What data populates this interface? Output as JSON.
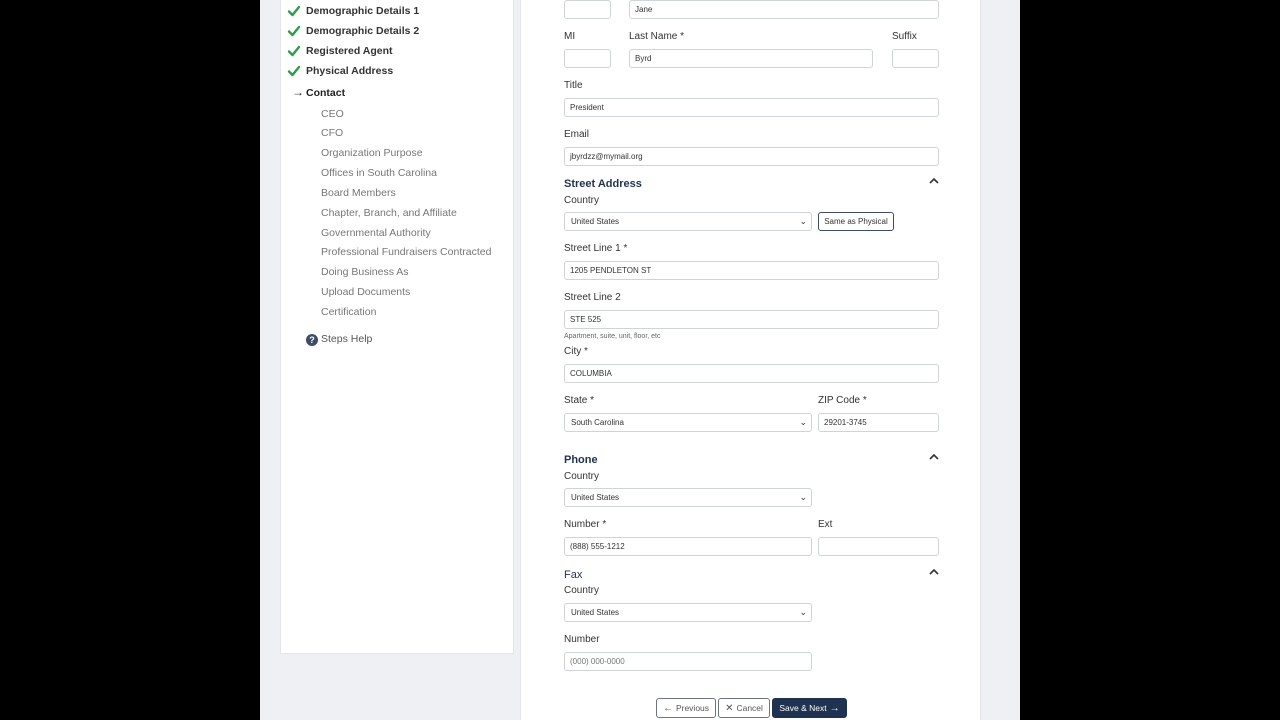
{
  "sidebar": {
    "completed_steps": [
      {
        "label": "Demographic Details 1"
      },
      {
        "label": "Demographic Details 2"
      },
      {
        "label": "Registered Agent"
      },
      {
        "label": "Physical Address"
      }
    ],
    "current_step": "Contact",
    "pending_steps": [
      "CEO",
      "CFO",
      "Organization Purpose",
      "Offices in South Carolina",
      "Board Members",
      "Chapter, Branch, and Affiliate",
      "Governmental Authority",
      "Professional Fundraisers Contracted",
      "Doing Business As",
      "Upload Documents",
      "Certification"
    ],
    "help_label": "Steps Help",
    "check_color": "#2e9d4a"
  },
  "contact": {
    "first_name_value": "Jane",
    "mi_label": "MI",
    "mi_value": "",
    "last_name_label": "Last Name *",
    "last_name_value": "Byrd",
    "suffix_label": "Suffix",
    "suffix_value": "",
    "title_label": "Title",
    "title_value": "President",
    "email_label": "Email",
    "email_value": "jbyrdzz@mymail.org"
  },
  "street_address": {
    "heading": "Street Address",
    "country_label": "Country",
    "country_value": "United States",
    "same_as_physical": "Same as Physical",
    "line1_label": "Street Line 1 *",
    "line1_value": "1205 PENDLETON ST",
    "line2_label": "Street Line 2",
    "line2_value": "STE 525",
    "line2_help": "Apartment, suite, unit, floor, etc",
    "city_label": "City *",
    "city_value": "COLUMBIA",
    "state_label": "State *",
    "state_value": "South Carolina",
    "zip_label": "ZIP Code *",
    "zip_value": "29201-3745"
  },
  "phone": {
    "heading": "Phone",
    "country_label": "Country",
    "country_value": "United States",
    "number_label": "Number *",
    "number_value": "(888) 555-1212",
    "ext_label": "Ext",
    "ext_value": ""
  },
  "fax": {
    "heading": "Fax",
    "country_label": "Country",
    "country_value": "United States",
    "number_label": "Number",
    "number_placeholder": "(000) 000-0000"
  },
  "footer": {
    "previous_label": "Previous",
    "cancel_label": "Cancel",
    "save_next_label": "Save & Next",
    "primary_color": "#1f3350"
  }
}
